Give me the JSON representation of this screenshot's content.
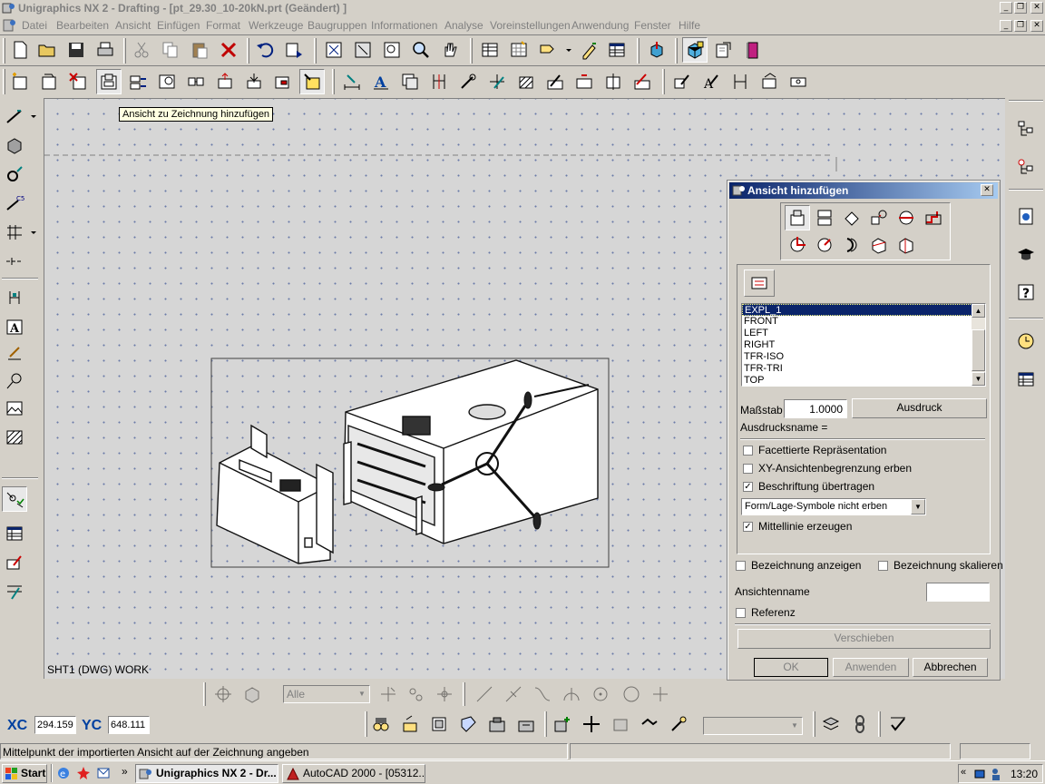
{
  "window": {
    "title": "Unigraphics NX 2 - Drafting - [pt_29.30_10-20kN.prt (Geändert) ]"
  },
  "menu": [
    "Datei",
    "Bearbeiten",
    "Ansicht",
    "Einfügen",
    "Format",
    "Werkzeuge",
    "Baugruppen",
    "Informationen",
    "Analyse",
    "Voreinstellungen",
    "Anwendung",
    "Fenster",
    "Hilfe"
  ],
  "tooltip": "Ansicht zu Zeichnung hinzufügen",
  "sheet_label": "SHT1 (DWG) WORK",
  "dialog": {
    "title": "Ansicht hinzufügen",
    "views": [
      "EXPL_1",
      "FRONT",
      "LEFT",
      "RIGHT",
      "TFR-ISO",
      "TFR-TRI",
      "TOP"
    ],
    "selected_view": "EXPL_1",
    "scale_label": "Maßstab",
    "scale_value": "1.0000",
    "ausdruck_button": "Ausdruck",
    "ausdrucksname_label": "Ausdrucksname =",
    "options": [
      {
        "label": "Facettierte Repräsentation",
        "checked": false
      },
      {
        "label": "XY-Ansichtenbegrenzung erben",
        "checked": false
      },
      {
        "label": "Beschriftung übertragen",
        "checked": true
      }
    ],
    "symbol_select": "Form/Lage-Symbole nicht erben",
    "centerline": {
      "label": "Mittellinie erzeugen",
      "checked": true
    },
    "show_name": {
      "label": "Bezeichnung anzeigen",
      "checked": false
    },
    "scale_name": {
      "label": "Bezeichnung skalieren",
      "checked": false
    },
    "view_name_label": "Ansichtenname",
    "view_name_value": "",
    "reference": {
      "label": "Referenz",
      "checked": false
    },
    "move_button": "Verschieben",
    "ok_button": "OK",
    "apply_button": "Anwenden",
    "cancel_button": "Abbrechen"
  },
  "bottom_toolbar": {
    "filter_select": "Alle"
  },
  "coords": {
    "xc_label": "XC",
    "xc_value": "294.159",
    "yc_label": "YC",
    "yc_value": "648.111"
  },
  "status": "Mittelpunkt der importierten Ansicht auf der Zeichnung angeben",
  "taskbar": {
    "start": "Start",
    "tasks": [
      "Unigraphics NX 2 - Dr...",
      "AutoCAD 2000 - [05312..."
    ],
    "clock": "13:20"
  },
  "colors": {
    "title_gradient_start": "#0a246a",
    "title_gradient_end": "#a6caf0",
    "selection": "#0a246a",
    "tooltip_bg": "#ffffe1"
  }
}
